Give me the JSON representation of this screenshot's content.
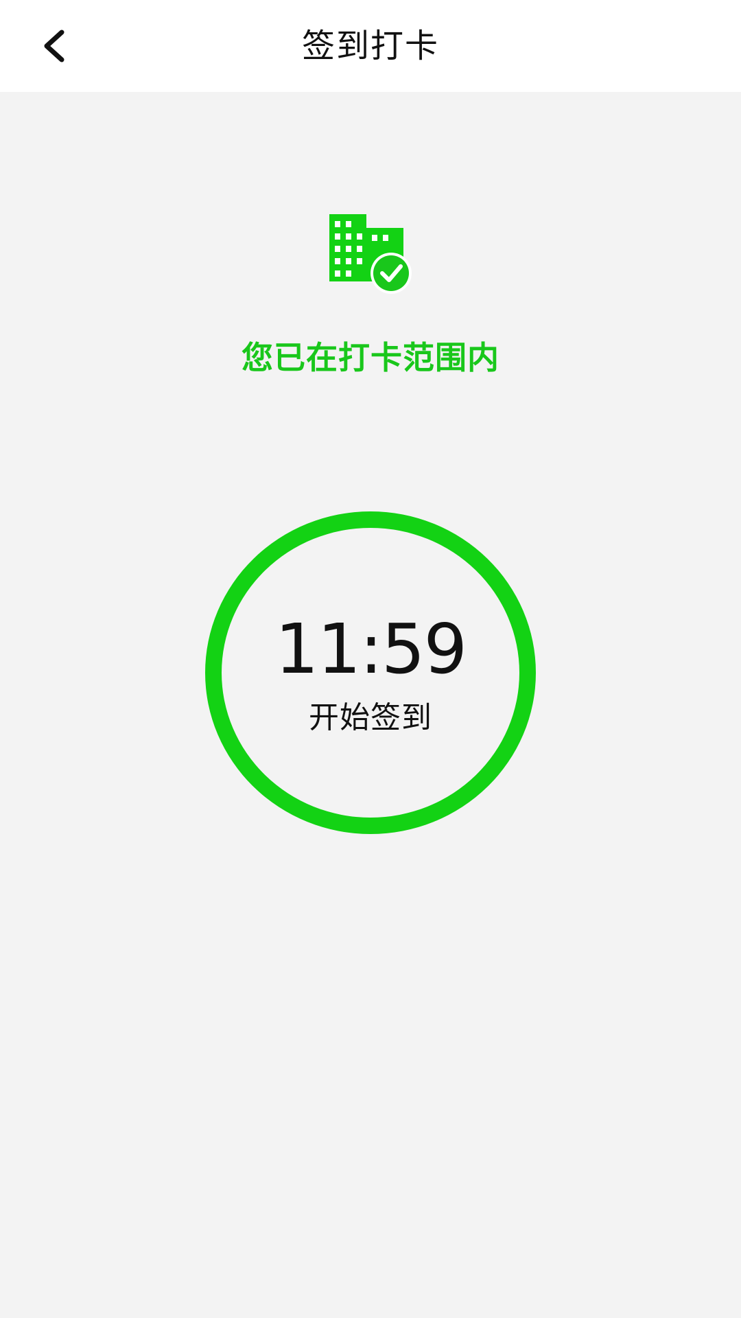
{
  "header": {
    "title": "签到打卡",
    "back_icon": "chevron-left-icon"
  },
  "status": {
    "icon": "building-check-icon",
    "text": "您已在打卡范围内",
    "color": "#19c71b"
  },
  "checkin": {
    "time": "11:59",
    "label": "开始签到",
    "ring_color": "#13d214"
  },
  "colors": {
    "background": "#f3f3f3",
    "header_background": "#ffffff",
    "text": "#111111"
  }
}
